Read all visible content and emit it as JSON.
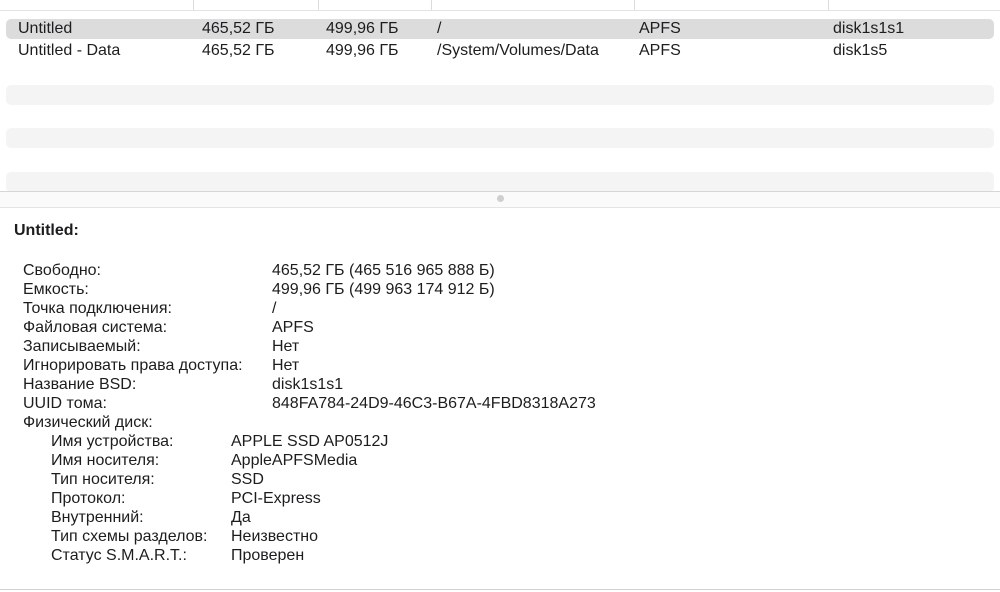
{
  "volumes": {
    "rows": [
      {
        "name": "Untitled",
        "free": "465,52 ГБ",
        "capacity": "499,96 ГБ",
        "mount": "/",
        "fs": "APFS",
        "bsd": "disk1s1s1"
      },
      {
        "name": "Untitled - Data",
        "free": "465,52 ГБ",
        "capacity": "499,96 ГБ",
        "mount": "/System/Volumes/Data",
        "fs": "APFS",
        "bsd": "disk1s5"
      }
    ]
  },
  "details": {
    "title": "Untitled:",
    "fields": [
      {
        "label": "Свободно:",
        "value": "465,52 ГБ (465 516 965 888 Б)"
      },
      {
        "label": "Емкость:",
        "value": "499,96 ГБ (499 963 174 912 Б)"
      },
      {
        "label": "Точка подключения:",
        "value": "/"
      },
      {
        "label": "Файловая система:",
        "value": "APFS"
      },
      {
        "label": "Записываемый:",
        "value": "Нет"
      },
      {
        "label": "Игнорировать права доступа:",
        "value": "Нет"
      },
      {
        "label": "Название BSD:",
        "value": "disk1s1s1"
      },
      {
        "label": "UUID тома:",
        "value": "848FA784-24D9-46C3-B67A-4FBD8318A273"
      }
    ],
    "physical_disk_label": "Физический диск:",
    "physical_fields": [
      {
        "label": "Имя устройства:",
        "value": "APPLE SSD AP0512J"
      },
      {
        "label": "Имя носителя:",
        "value": "AppleAPFSMedia"
      },
      {
        "label": "Тип носителя:",
        "value": "SSD"
      },
      {
        "label": "Протокол:",
        "value": "PCI-Express"
      },
      {
        "label": "Внутренний:",
        "value": "Да"
      },
      {
        "label": "Тип схемы разделов:",
        "value": "Неизвестно"
      },
      {
        "label": "Статус S.M.A.R.T.:",
        "value": "Проверен"
      }
    ]
  },
  "colors": {
    "selected_row": "#dcdcdc",
    "alt_row": "#f4f4f5",
    "text": "#1d1d1f"
  }
}
